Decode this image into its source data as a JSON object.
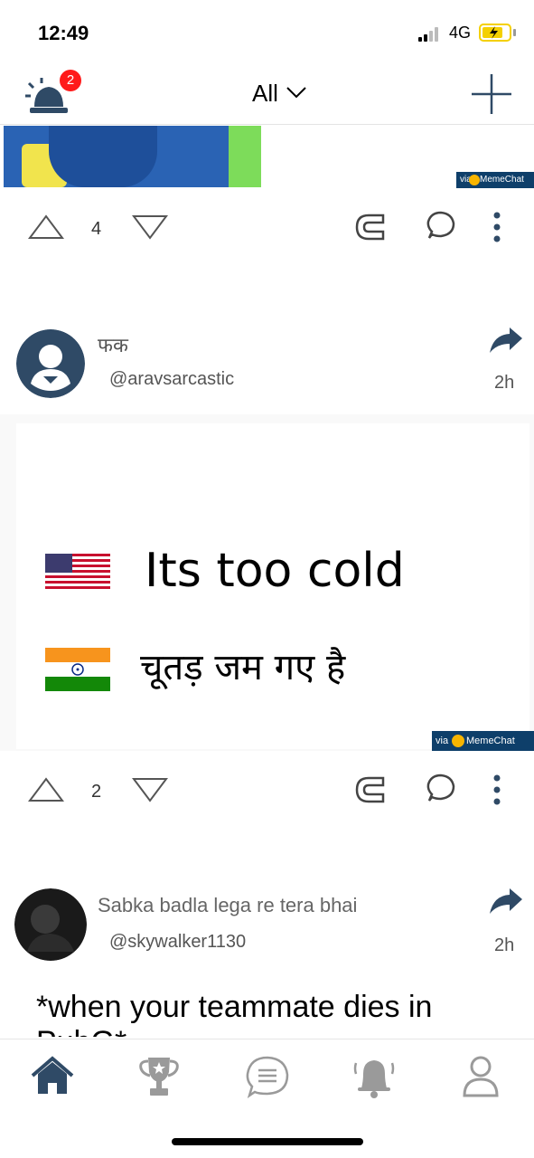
{
  "status": {
    "time": "12:49",
    "network": "4G"
  },
  "nav": {
    "notification_count": "2",
    "filter_label": "All"
  },
  "post1": {
    "upvotes": "4",
    "watermark": "MemeChat App",
    "watermark_via": "via"
  },
  "post2": {
    "title": "फक",
    "handle": "@aravsarcastic",
    "time": "2h",
    "meme_line_1": "Its too cold",
    "meme_line_2": "चूतड़ जम गए है",
    "watermark": "MemeChat App",
    "watermark_via": "via",
    "upvotes": "2"
  },
  "post3": {
    "title": "Sabka badla lega re tera bhai",
    "handle": "@skywalker1130",
    "time": "2h",
    "text": "*when your teammate dies in PubG*"
  },
  "tabs": [
    "home-icon",
    "trophy-icon",
    "chat-icon",
    "notifications-icon",
    "profile-icon"
  ],
  "colors": {
    "accent": "#2f4a66",
    "badge": "#ff1a1a",
    "watermark_bg": "#0e3f6a",
    "icon_gray": "#9a9a9a"
  }
}
